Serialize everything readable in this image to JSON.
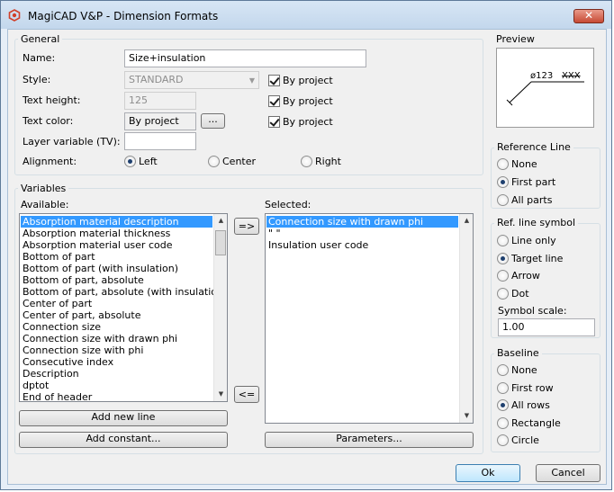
{
  "window": {
    "title": "MagiCAD V&P - Dimension Formats",
    "close_glyph": "✕"
  },
  "general": {
    "title": "General",
    "name_label": "Name:",
    "name_value": "Size+insulation",
    "style_label": "Style:",
    "style_value": "STANDARD",
    "text_height_label": "Text height:",
    "text_height_value": "125",
    "text_color_label": "Text color:",
    "text_color_value": "By project",
    "color_browse": "...",
    "layer_label": "Layer variable (TV):",
    "layer_value": "",
    "alignment_label": "Alignment:",
    "align_left": "Left",
    "align_center": "Center",
    "align_right": "Right",
    "by_project_1": "By project",
    "by_project_2": "By project",
    "by_project_3": "By project"
  },
  "variables": {
    "title": "Variables",
    "available_label": "Available:",
    "selected_label": "Selected:",
    "available_items": [
      "Absorption material description",
      "Absorption material thickness",
      "Absorption material user code",
      "Bottom of part",
      "Bottom of part (with insulation)",
      "Bottom of part, absolute",
      "Bottom of part, absolute (with insulation)",
      "Center of part",
      "Center of part, absolute",
      "Connection size",
      "Connection size with drawn phi",
      "Connection size with phi",
      "Consecutive index",
      "Description",
      "dptot",
      "End of header"
    ],
    "selected_items": [
      "Connection size with drawn phi",
      "\" \"",
      "Insulation user code"
    ],
    "add_button": "=>",
    "remove_button": "<=",
    "add_new_line": "Add new line",
    "add_constant": "Add constant...",
    "parameters": "Parameters..."
  },
  "preview": {
    "title": "Preview",
    "sample_text": "ø123",
    "sample_crossed": "XXX"
  },
  "reference_line": {
    "title": "Reference Line",
    "options": [
      "None",
      "First part",
      "All parts"
    ],
    "selected": "First part"
  },
  "ref_line_symbol": {
    "title": "Ref. line symbol",
    "options": [
      "Line only",
      "Target line",
      "Arrow",
      "Dot"
    ],
    "selected": "Target line",
    "scale_label": "Symbol scale:",
    "scale_value": "1.00"
  },
  "baseline": {
    "title": "Baseline",
    "options": [
      "None",
      "First row",
      "All rows",
      "Rectangle",
      "Circle"
    ],
    "selected": "All rows"
  },
  "footer": {
    "ok": "Ok",
    "cancel": "Cancel"
  },
  "colors": {
    "selection": "#3399ff",
    "titlebar": "#c3d7ec",
    "close": "#c74a35"
  }
}
